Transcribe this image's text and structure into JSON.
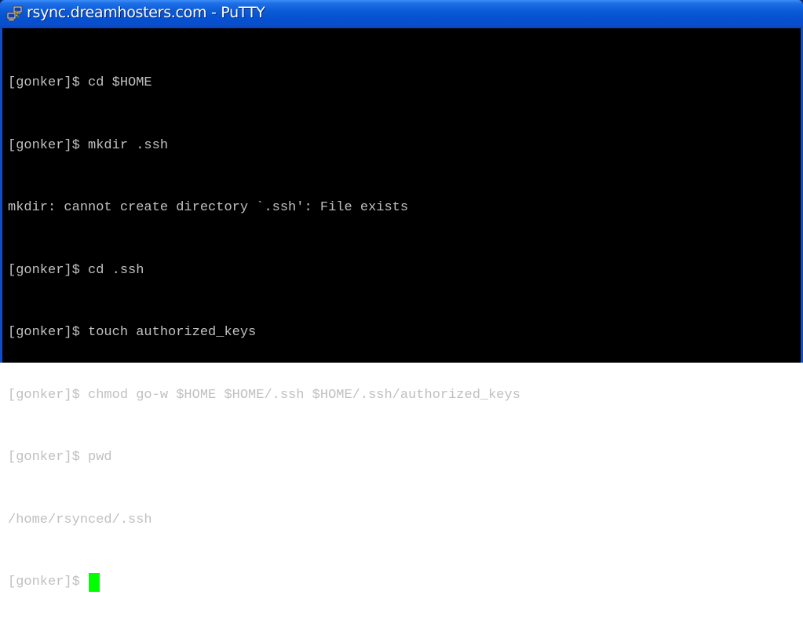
{
  "window": {
    "title": "rsync.dreamhosters.com - PuTTY",
    "icon": "putty-icon"
  },
  "terminal": {
    "lines": [
      "[gonker]$ cd $HOME",
      "[gonker]$ mkdir .ssh",
      "mkdir: cannot create directory `.ssh': File exists",
      "[gonker]$ cd .ssh",
      "[gonker]$ touch authorized_keys",
      "[gonker]$ chmod go-w $HOME $HOME/.ssh $HOME/.ssh/authorized_keys",
      "[gonker]$ pwd",
      "/home/rsynced/.ssh"
    ],
    "current_prompt": "[gonker]$ ",
    "cursor_color": "#00ff00",
    "text_color": "#c0c0c0",
    "background_color": "#000000"
  }
}
